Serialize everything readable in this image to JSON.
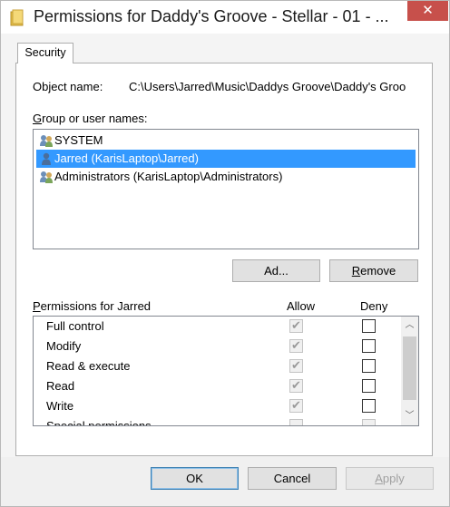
{
  "window": {
    "title": "Permissions for Daddy's Groove - Stellar - 01 - ...",
    "close_glyph": "✕"
  },
  "tabs": [
    {
      "label": "Security"
    }
  ],
  "object_name": {
    "label": "Object name:",
    "value": "C:\\Users\\Jarred\\Music\\Daddys Groove\\Daddy's Groo"
  },
  "group_label": {
    "prefix": "",
    "mnemonic": "G",
    "rest": "roup or user names:"
  },
  "users": [
    {
      "label": "SYSTEM",
      "icon": "users-group-icon",
      "selected": false
    },
    {
      "label": "Jarred (KarisLaptop\\Jarred)",
      "icon": "user-icon",
      "selected": true
    },
    {
      "label": "Administrators (KarisLaptop\\Administrators)",
      "icon": "users-group-icon",
      "selected": false
    }
  ],
  "buttons": {
    "add": {
      "mnemonic": "",
      "prefix": "Ad",
      "underlined": "d",
      "rest": "..."
    },
    "remove": {
      "prefix": "",
      "underlined": "R",
      "rest": "emove"
    },
    "ok": "OK",
    "cancel": "Cancel",
    "apply": {
      "prefix": "",
      "underlined": "A",
      "rest": "pply"
    }
  },
  "permissions": {
    "label_prefix": "",
    "label_mnemonic": "P",
    "label_rest": "ermissions for Jarred",
    "allow_header": "Allow",
    "deny_header": "Deny",
    "rows": [
      {
        "name": "Full control",
        "allow": true,
        "deny": false
      },
      {
        "name": "Modify",
        "allow": true,
        "deny": false
      },
      {
        "name": "Read & execute",
        "allow": true,
        "deny": false
      },
      {
        "name": "Read",
        "allow": true,
        "deny": false
      },
      {
        "name": "Write",
        "allow": true,
        "deny": false
      },
      {
        "name": "Special permissions",
        "allow": false,
        "deny": false
      }
    ]
  },
  "colors": {
    "selection": "#3399ff",
    "close_button": "#c7504b",
    "default_button_border": "#3c7fb1"
  }
}
